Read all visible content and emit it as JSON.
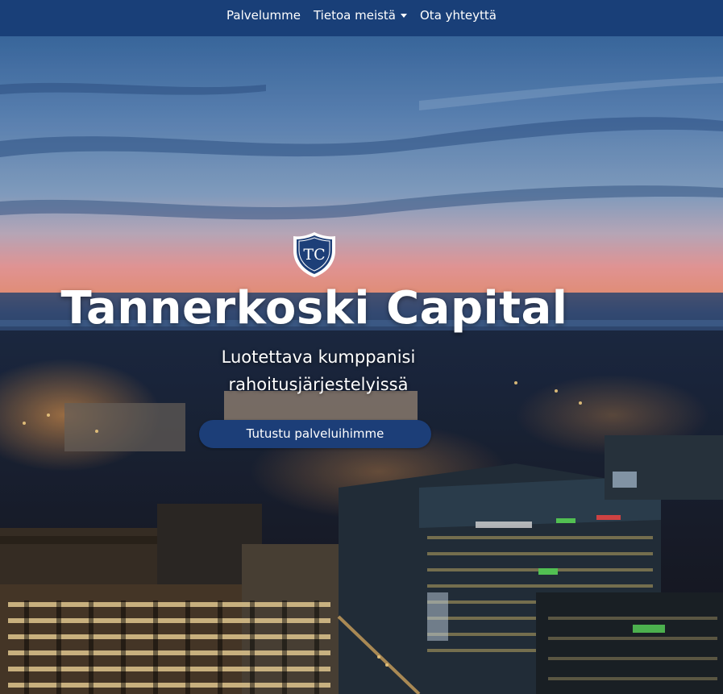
{
  "nav": {
    "items": [
      {
        "label": "Palvelumme"
      },
      {
        "label": "Tietoa meistä",
        "has_dropdown": true
      },
      {
        "label": "Ota yhteyttä"
      }
    ]
  },
  "hero": {
    "logo": {
      "monogram": "TC",
      "icon": "shield-crest-icon"
    },
    "title": "Tannerkoski Capital",
    "subtitle_line1": "Luotettava kumppanisi",
    "subtitle_line2": "rahoitusjärjestelyissä",
    "cta_label": "Tutustu palveluihimme"
  },
  "colors": {
    "navbar": "#193f78",
    "button": "#1c3e78",
    "text": "#ffffff"
  }
}
